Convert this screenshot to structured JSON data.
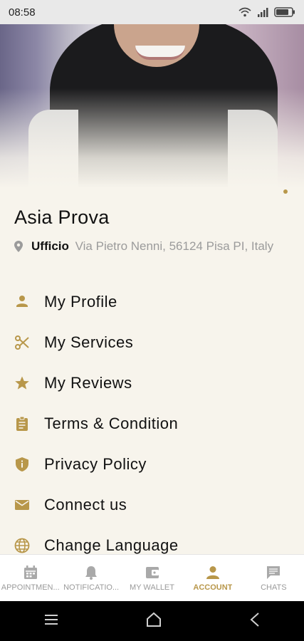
{
  "status_bar": {
    "time": "08:58"
  },
  "profile": {
    "name": "Asia Prova",
    "address_label": "Ufficio",
    "address": "Via Pietro Nenni, 56124 Pisa PI, Italy"
  },
  "menu": [
    {
      "label": "My Profile",
      "icon": "person-icon"
    },
    {
      "label": "My Services",
      "icon": "scissors-icon"
    },
    {
      "label": "My Reviews",
      "icon": "star-icon"
    },
    {
      "label": "Terms & Condition",
      "icon": "clipboard-icon"
    },
    {
      "label": "Privacy Policy",
      "icon": "shield-icon"
    },
    {
      "label": "Connect us",
      "icon": "mail-icon"
    },
    {
      "label": "Change Language",
      "icon": "globe-icon"
    }
  ],
  "bottom_nav": [
    {
      "label": "APPOINTMEN...",
      "icon": "calendar-icon",
      "active": false
    },
    {
      "label": "NOTIFICATIO...",
      "icon": "bell-icon",
      "active": false
    },
    {
      "label": "MY WALLET",
      "icon": "wallet-icon",
      "active": false
    },
    {
      "label": "ACCOUNT",
      "icon": "account-icon",
      "active": true
    },
    {
      "label": "CHATS",
      "icon": "chat-icon",
      "active": false
    }
  ],
  "colors": {
    "accent": "#b8974a",
    "background": "#f7f4ec",
    "inactive": "#a9a9a9"
  }
}
